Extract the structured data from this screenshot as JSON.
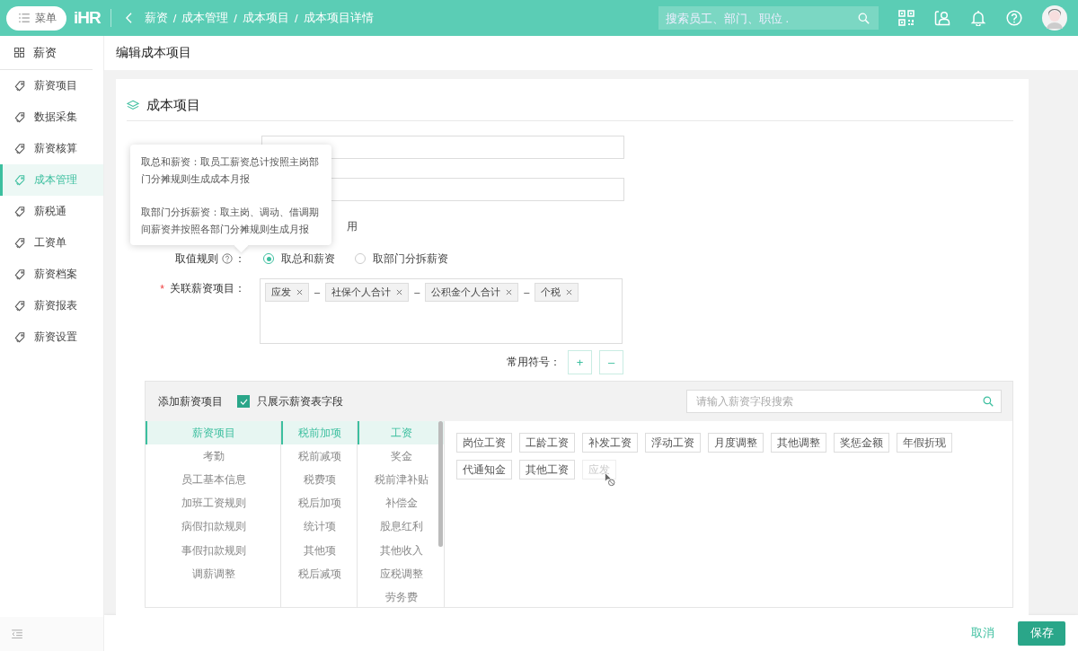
{
  "topbar": {
    "menu_button": "菜单",
    "logo": "iHR",
    "breadcrumb": [
      "薪资",
      "成本管理",
      "成本项目",
      "成本项目详情"
    ],
    "breadcrumb_separator": "/",
    "search": {
      "placeholder": "搜索员工、部门、职位 ."
    }
  },
  "sidebar": {
    "header": "薪资",
    "items": [
      {
        "label": "薪资项目",
        "selected": false
      },
      {
        "label": "数据采集",
        "selected": false
      },
      {
        "label": "薪资核算",
        "selected": false
      },
      {
        "label": "成本管理",
        "selected": true
      },
      {
        "label": "薪税通",
        "selected": false
      },
      {
        "label": "工资单",
        "selected": false
      },
      {
        "label": "薪资档案",
        "selected": false
      },
      {
        "label": "薪资报表",
        "selected": false
      },
      {
        "label": "薪资设置",
        "selected": false
      }
    ]
  },
  "page_title": "编辑成本项目",
  "section_title": "成本项目",
  "tooltip": {
    "paragraphs": [
      "取总和薪资：取员工薪资总计按照主岗部门分摊规则生成成本月报",
      "取部门分拆薪资：取主岗、调动、借调期间薪资并按照各部门分摊规则生成月报"
    ]
  },
  "partial_text": "用",
  "value_rule": {
    "label": "取值规则",
    "colon": "：",
    "options": [
      {
        "label": "取总和薪资",
        "selected": true
      },
      {
        "label": "取部门分拆薪资",
        "selected": false
      }
    ]
  },
  "linked_items": {
    "label": "关联薪资项目：",
    "required_mark": "*",
    "tokens": [
      {
        "kind": "tag",
        "text": "应发"
      },
      {
        "kind": "operator",
        "text": "–"
      },
      {
        "kind": "tag",
        "text": "社保个人合计"
      },
      {
        "kind": "operator",
        "text": "–"
      },
      {
        "kind": "tag",
        "text": "公积金个人合计"
      },
      {
        "kind": "operator",
        "text": "–"
      },
      {
        "kind": "tag",
        "text": "个税"
      }
    ]
  },
  "symbols": {
    "label": "常用符号：",
    "buttons": [
      "+",
      "–"
    ]
  },
  "picker": {
    "title": "添加薪资项目",
    "filter": {
      "label": "只展示薪资表字段",
      "checked": true
    },
    "search": {
      "placeholder": "请输入薪资字段搜索"
    },
    "categories": [
      {
        "label": "薪资项目",
        "selected": true
      },
      {
        "label": "考勤",
        "selected": false
      },
      {
        "label": "员工基本信息",
        "selected": false
      },
      {
        "label": "加班工资规则",
        "selected": false
      },
      {
        "label": "病假扣款规则",
        "selected": false
      },
      {
        "label": "事假扣款规则",
        "selected": false
      },
      {
        "label": "调薪调整",
        "selected": false
      }
    ],
    "groups": [
      {
        "label": "税前加项",
        "selected": true
      },
      {
        "label": "税前减项",
        "selected": false
      },
      {
        "label": "税费项",
        "selected": false
      },
      {
        "label": "税后加项",
        "selected": false
      },
      {
        "label": "统计项",
        "selected": false
      },
      {
        "label": "其他项",
        "selected": false
      },
      {
        "label": "税后减项",
        "selected": false
      }
    ],
    "subgroups": [
      {
        "label": "工资",
        "selected": true
      },
      {
        "label": "奖金",
        "selected": false
      },
      {
        "label": "税前津补贴",
        "selected": false
      },
      {
        "label": "补偿金",
        "selected": false
      },
      {
        "label": "股息红利",
        "selected": false
      },
      {
        "label": "其他收入",
        "selected": false
      },
      {
        "label": "应税调整",
        "selected": false
      },
      {
        "label": "劳务费",
        "selected": false
      }
    ],
    "fields": [
      {
        "text": "岗位工资",
        "disabled": false
      },
      {
        "text": "工龄工资",
        "disabled": false
      },
      {
        "text": "补发工资",
        "disabled": false
      },
      {
        "text": "浮动工资",
        "disabled": false
      },
      {
        "text": "月度调整",
        "disabled": false
      },
      {
        "text": "其他调整",
        "disabled": false
      },
      {
        "text": "奖惩金额",
        "disabled": false
      },
      {
        "text": "年假折现",
        "disabled": false
      },
      {
        "text": "代通知金",
        "disabled": false
      },
      {
        "text": "其他工资",
        "disabled": false
      },
      {
        "text": "应发",
        "disabled": true
      }
    ]
  },
  "footer": {
    "cancel": "取消",
    "save": "保存"
  }
}
